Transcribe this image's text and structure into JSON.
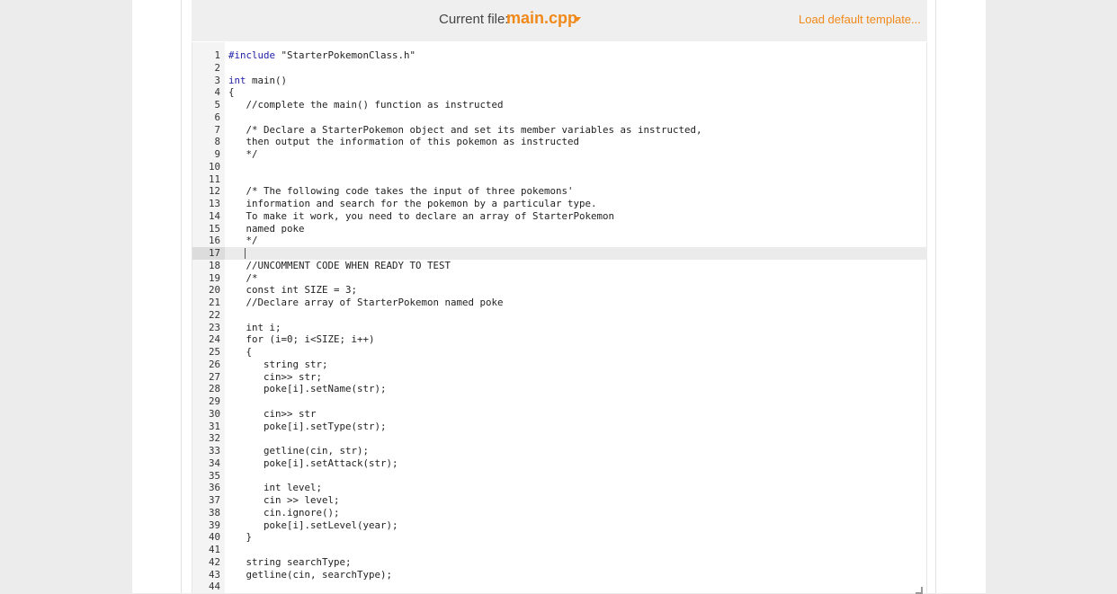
{
  "header": {
    "current_file_label": "Current file:",
    "file_name": "main.cpp",
    "load_template": "Load default template..."
  },
  "editor": {
    "active_line": 17,
    "lines": [
      {
        "n": "1",
        "text": "#include \"StarterPokemonClass.h\""
      },
      {
        "n": "2",
        "text": ""
      },
      {
        "n": "3",
        "text": "int main()"
      },
      {
        "n": "4",
        "text": "{"
      },
      {
        "n": "5",
        "text": "   //complete the main() function as instructed"
      },
      {
        "n": "6",
        "text": ""
      },
      {
        "n": "7",
        "text": "   /* Declare a StarterPokemon object and set its member variables as instructed,"
      },
      {
        "n": "8",
        "text": "   then output the information of this pokemon as instructed"
      },
      {
        "n": "9",
        "text": "   */"
      },
      {
        "n": "10",
        "text": ""
      },
      {
        "n": "11",
        "text": ""
      },
      {
        "n": "12",
        "text": "   /* The following code takes the input of three pokemons'"
      },
      {
        "n": "13",
        "text": "   information and search for the pokemon by a particular type."
      },
      {
        "n": "14",
        "text": "   To make it work, you need to declare an array of StarterPokemon"
      },
      {
        "n": "15",
        "text": "   named poke"
      },
      {
        "n": "16",
        "text": "   */"
      },
      {
        "n": "17",
        "text": ""
      },
      {
        "n": "18",
        "text": "   //UNCOMMENT CODE WHEN READY TO TEST"
      },
      {
        "n": "19",
        "text": "   /*"
      },
      {
        "n": "20",
        "text": "   const int SIZE = 3;"
      },
      {
        "n": "21",
        "text": "   //Declare array of StarterPokemon named poke"
      },
      {
        "n": "22",
        "text": ""
      },
      {
        "n": "23",
        "text": "   int i;"
      },
      {
        "n": "24",
        "text": "   for (i=0; i<SIZE; i++)"
      },
      {
        "n": "25",
        "text": "   {"
      },
      {
        "n": "26",
        "text": "      string str;"
      },
      {
        "n": "27",
        "text": "      cin>> str;"
      },
      {
        "n": "28",
        "text": "      poke[i].setName(str);"
      },
      {
        "n": "29",
        "text": ""
      },
      {
        "n": "30",
        "text": "      cin>> str"
      },
      {
        "n": "31",
        "text": "      poke[i].setType(str);"
      },
      {
        "n": "32",
        "text": ""
      },
      {
        "n": "33",
        "text": "      getline(cin, str);"
      },
      {
        "n": "34",
        "text": "      poke[i].setAttack(str);"
      },
      {
        "n": "35",
        "text": ""
      },
      {
        "n": "36",
        "text": "      int level;"
      },
      {
        "n": "37",
        "text": "      cin >> level;"
      },
      {
        "n": "38",
        "text": "      cin.ignore();"
      },
      {
        "n": "39",
        "text": "      poke[i].setLevel(year);"
      },
      {
        "n": "40",
        "text": "   }"
      },
      {
        "n": "41",
        "text": ""
      },
      {
        "n": "42",
        "text": "   string searchType;"
      },
      {
        "n": "43",
        "text": "   getline(cin, searchType);"
      },
      {
        "n": "44",
        "text": ""
      }
    ]
  },
  "colors": {
    "accent": "#f0891a",
    "keyword": "#1e1ea8"
  }
}
